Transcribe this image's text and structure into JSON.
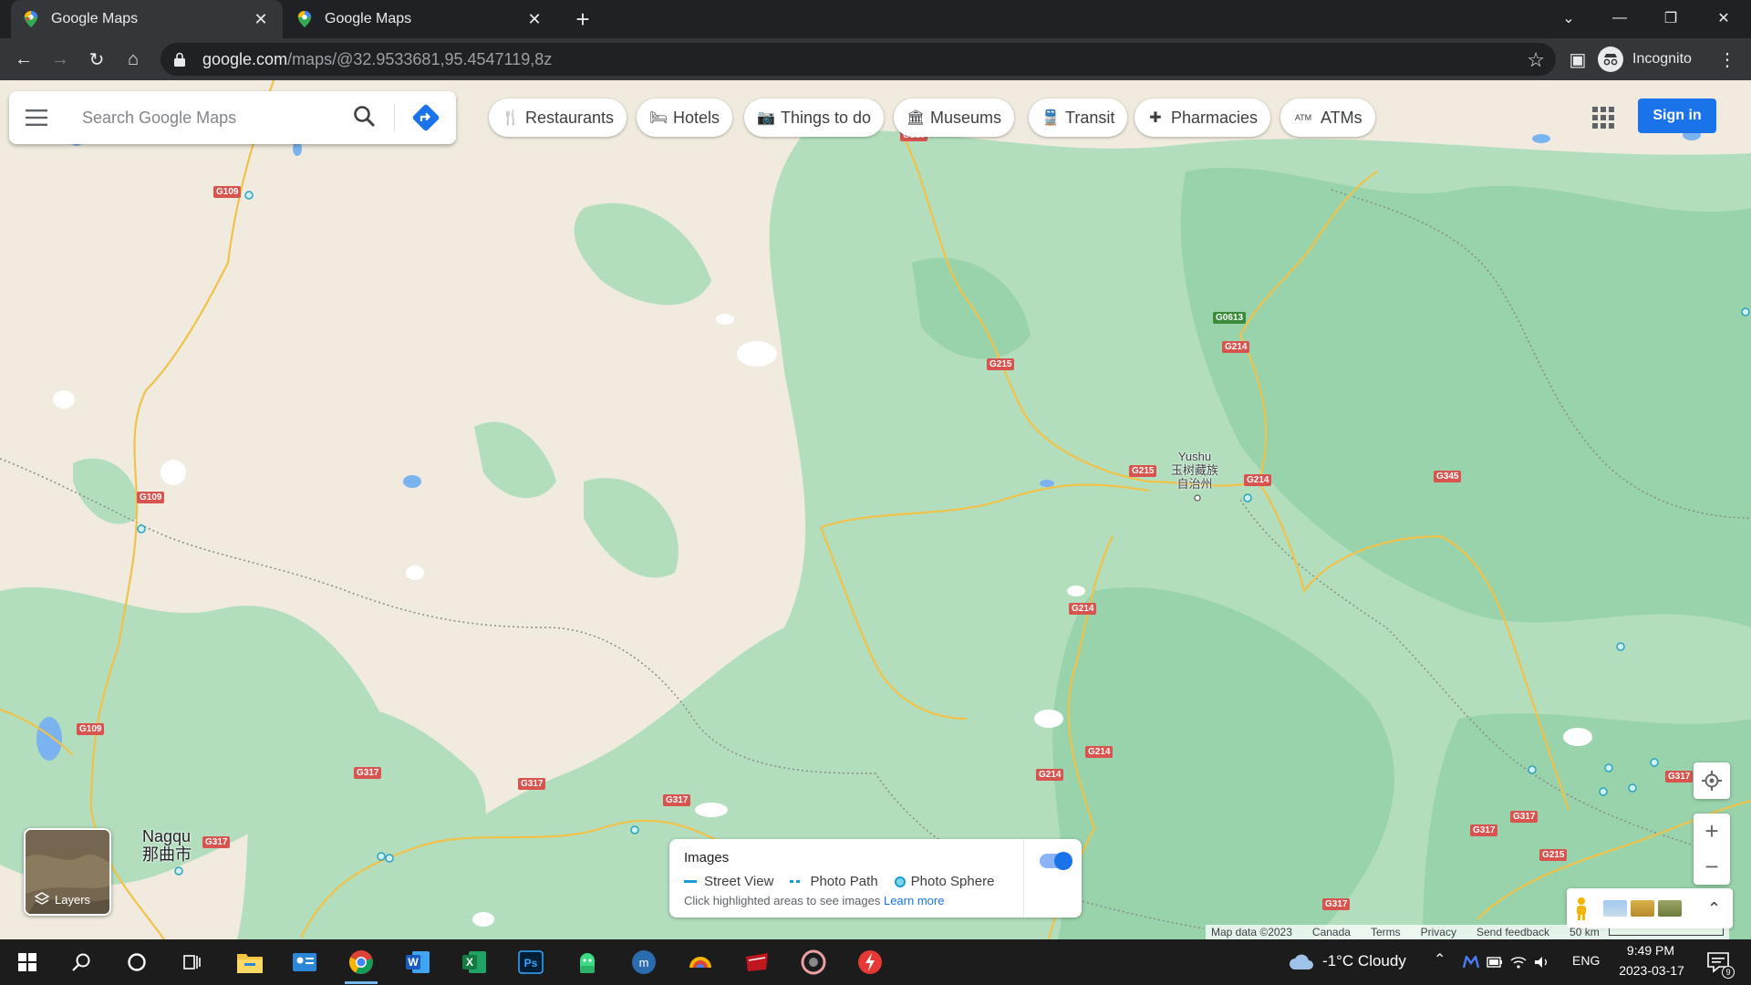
{
  "browser": {
    "tabs": [
      {
        "title": "Google Maps",
        "active": true
      },
      {
        "title": "Google Maps",
        "active": false
      }
    ],
    "url_host": "google.com",
    "url_path": "/maps/@32.9533681,95.4547119,8z",
    "profile_label": "Incognito"
  },
  "maps": {
    "search_placeholder": "Search Google Maps",
    "chips": [
      {
        "label": "Restaurants",
        "icon": "fork-knife-icon"
      },
      {
        "label": "Hotels",
        "icon": "bed-icon"
      },
      {
        "label": "Things to do",
        "icon": "camera-icon"
      },
      {
        "label": "Museums",
        "icon": "museum-icon"
      },
      {
        "label": "Transit",
        "icon": "train-icon"
      },
      {
        "label": "Pharmacies",
        "icon": "pharmacy-icon"
      },
      {
        "label": "ATMs",
        "icon": "atm-icon"
      }
    ],
    "sign_in": "Sign in",
    "layers_label": "Layers",
    "images_panel": {
      "title": "Images",
      "street_view": "Street View",
      "photo_path": "Photo Path",
      "photo_sphere": "Photo Sphere",
      "hint": "Click highlighted areas to see images",
      "learn_more": "Learn more",
      "toggle_on": true
    },
    "places": {
      "yushu_en": "Yushu",
      "yushu_zh": "玉树藏族",
      "yushu_zh2": "自治州",
      "nagqu_en": "Nagqu",
      "nagqu_zh": "那曲市"
    },
    "road_labels": {
      "g109": "G109",
      "g215": "G215",
      "g0613": "G0613",
      "g214": "G214",
      "g345": "G345",
      "g317": "G317"
    },
    "footer": {
      "map_data": "Map data ©2023",
      "country": "Canada",
      "terms": "Terms",
      "privacy": "Privacy",
      "feedback": "Send feedback",
      "scale": "50 km"
    }
  },
  "taskbar": {
    "weather": "-1°C  Cloudy",
    "lang": "ENG",
    "time": "9:49 PM",
    "date": "2023-03-17",
    "notification_count": "9"
  }
}
